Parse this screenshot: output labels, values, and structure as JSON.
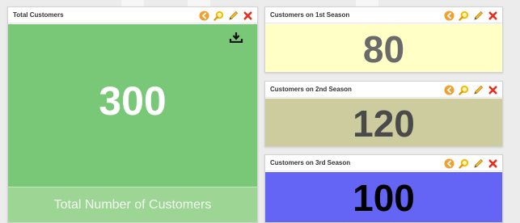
{
  "colors": {
    "page_background": "#ececec",
    "panel_header": "#ffffff",
    "total_body": "#78c878",
    "total_footer": "#9cd594",
    "season1_body": "#ffffc6",
    "season2_body": "#cccc9e",
    "season3_body": "#6464f5",
    "back_icon": "#f0a030",
    "zoom_icon": "#f5b800",
    "edit_icon": "#f0c020",
    "close_icon": "#e53020"
  },
  "icons": {
    "panel_tools": [
      "back-icon",
      "zoom-icon",
      "edit-icon",
      "close-icon"
    ],
    "download": "download-icon"
  },
  "widgets": {
    "total": {
      "title": "Total Customers",
      "value": "300",
      "footer": "Total Number of Customers"
    },
    "season1": {
      "title": "Customers on 1st Season",
      "value": "80"
    },
    "season2": {
      "title": "Customers on 2nd Season",
      "value": "120"
    },
    "season3": {
      "title": "Customers on 3rd Season",
      "value": "100"
    }
  }
}
